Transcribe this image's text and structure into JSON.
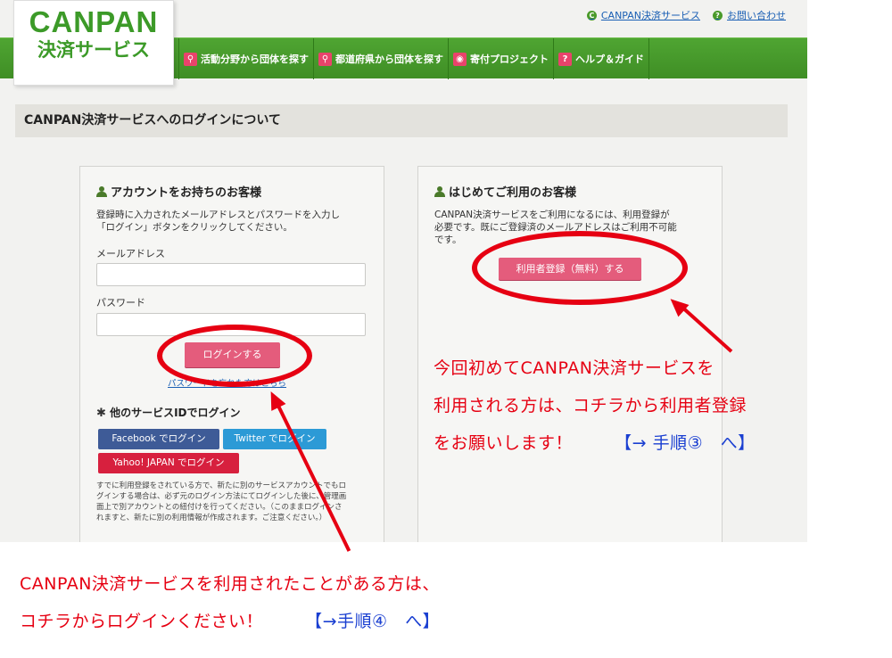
{
  "top_links": [
    {
      "label": "CANPAN決済サービス",
      "icon": "c-circle-icon"
    },
    {
      "label": "お問い合わせ",
      "icon": "q-circle-icon"
    }
  ],
  "logo": {
    "main": "CANPAN",
    "sub": "決済サービス"
  },
  "nav": [
    {
      "label": "活動分野から団体を探す",
      "icon": "search-icon"
    },
    {
      "label": "都道府県から団体を探す",
      "icon": "search-icon"
    },
    {
      "label": "寄付プロジェクト",
      "icon": "pin-icon"
    },
    {
      "label": "ヘルプ＆ガイド",
      "icon": "question-icon"
    }
  ],
  "section_title": "CANPAN決済サービスへのログインについて",
  "left_panel": {
    "heading": "アカウントをお持ちのお客様",
    "description_1": "登録時に入力されたメールアドレスとパスワードを入力し",
    "description_2": "「ログイン」ボタンをクリックしてください。",
    "email_label": "メールアドレス",
    "password_label": "パスワード",
    "login_button": "ログインする",
    "forgot_link": "パスワードを忘れた方はこちら",
    "social_heading": "他のサービスIDでログイン",
    "facebook_button": "Facebook でログイン",
    "twitter_button": "Twitter でログイン",
    "yahoo_button": "Yahoo! JAPAN でログイン",
    "note_1": "すでに利用登録をされている方で、新たに別のサービスアカウントでもロ",
    "note_2": "グインする場合は、必ず元のログイン方法にてログインした後に、管理画",
    "note_3": "面上で別アカウントとの紐付けを行ってください。（このままログインさ",
    "note_4": "れますと、新たに別の利用情報が作成されます。ご注意ください。）"
  },
  "right_panel": {
    "heading": "はじめてご利用のお客様",
    "description_1": "CANPAN決済サービスをご利用になるには、利用登録が",
    "description_2": "必要です。既にご登録済のメールアドレスはご利用不可能",
    "description_3": "です。",
    "register_button": "利用者登録（無料）する"
  },
  "annotations": {
    "right_line_1": "今回初めてCANPAN決済サービスを",
    "right_line_2": "利用される方は、コチラから利用者登録",
    "right_line_3": "をお願いします！",
    "right_step": "【→ 手順③　へ】",
    "bottom_line_1": "CANPAN決済サービスを利用されたことがある方は、",
    "bottom_line_2": "コチラからログインください！",
    "bottom_step": "【→手順④　へ】"
  },
  "colors": {
    "brand_green": "#3c9a28",
    "button_pink": "#e45c7c",
    "annotation_red": "#e60012",
    "annotation_blue": "#1a3fd1"
  }
}
